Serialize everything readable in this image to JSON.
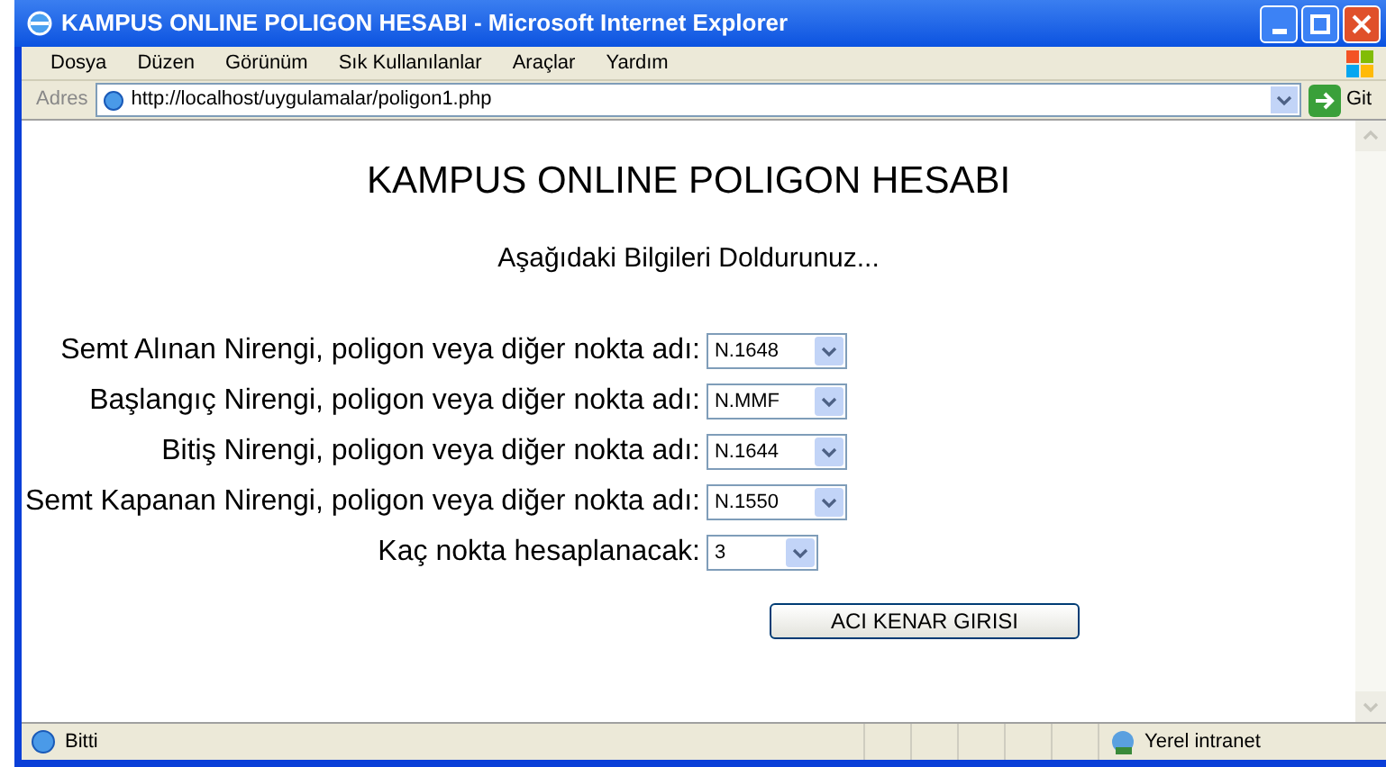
{
  "window": {
    "title": "KAMPUS ONLINE POLIGON HESABI - Microsoft Internet Explorer"
  },
  "menu": [
    "Dosya",
    "Düzen",
    "Görünüm",
    "Sık Kullanılanlar",
    "Araçlar",
    "Yardım"
  ],
  "address_bar": {
    "label": "Adres",
    "url": "http://localhost/uygulamalar/poligon1.php",
    "go_button": "Git"
  },
  "page": {
    "heading": "KAMPUS ONLINE POLIGON HESABI",
    "subheading": "Aşağıdaki Bilgileri Doldurunuz...",
    "fields": [
      {
        "label": "Semt Alınan Nirengi, poligon veya diğer nokta adı:",
        "value": "N.1648"
      },
      {
        "label": "Başlangıç Nirengi, poligon veya diğer nokta adı:",
        "value": "N.MMF"
      },
      {
        "label": "Bitiş Nirengi, poligon veya diğer nokta adı:",
        "value": "N.1644"
      },
      {
        "label": "Semt Kapanan Nirengi, poligon veya diğer nokta adı:",
        "value": "N.1550"
      },
      {
        "label": "Kaç nokta hesaplanacak:",
        "value": "3"
      }
    ],
    "button": "ACI KENAR GIRISI"
  },
  "status_bar": {
    "status": "Bitti",
    "zone": "Yerel intranet"
  }
}
